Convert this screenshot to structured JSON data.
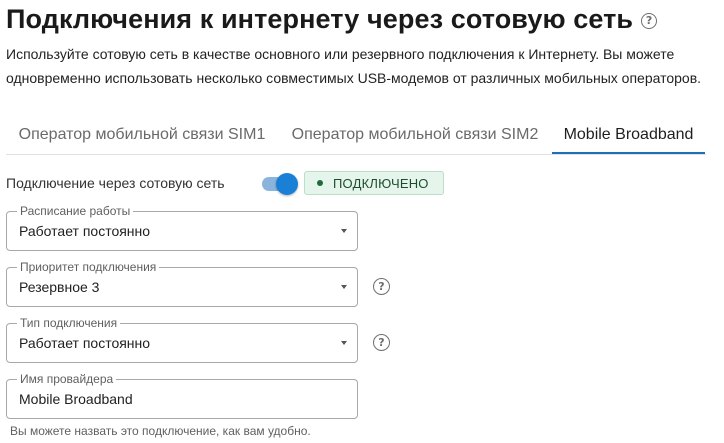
{
  "page": {
    "title": "Подключения к интернету через сотовую сеть",
    "help_icon": "question-circle-icon",
    "description": "Используйте сотовую сеть в качестве основного или резервного подключения к Интернету. Вы можете одновременно использовать несколько совместимых USB-модемов от различных мобильных операторов."
  },
  "tabs": [
    {
      "label": "Оператор мобильной связи SIM1",
      "active": false
    },
    {
      "label": "Оператор мобильной связи SIM2",
      "active": false
    },
    {
      "label": "Mobile Broadband",
      "active": true
    }
  ],
  "connection": {
    "label": "Подключение через сотовую сеть",
    "enabled": true,
    "status": "ПОДКЛЮЧЕНО",
    "status_color": "#1f6b3a",
    "accent_color": "#1a80d6"
  },
  "fields": {
    "schedule": {
      "label": "Расписание работы",
      "value": "Работает постоянно"
    },
    "priority": {
      "label": "Приоритет подключения",
      "value": "Резервное 3"
    },
    "type": {
      "label": "Тип подключения",
      "value": "Работает постоянно"
    },
    "provider": {
      "label": "Имя провайдера",
      "value": "Mobile Broadband",
      "hint": "Вы можете назвать это подключение, как вам удобно."
    }
  }
}
